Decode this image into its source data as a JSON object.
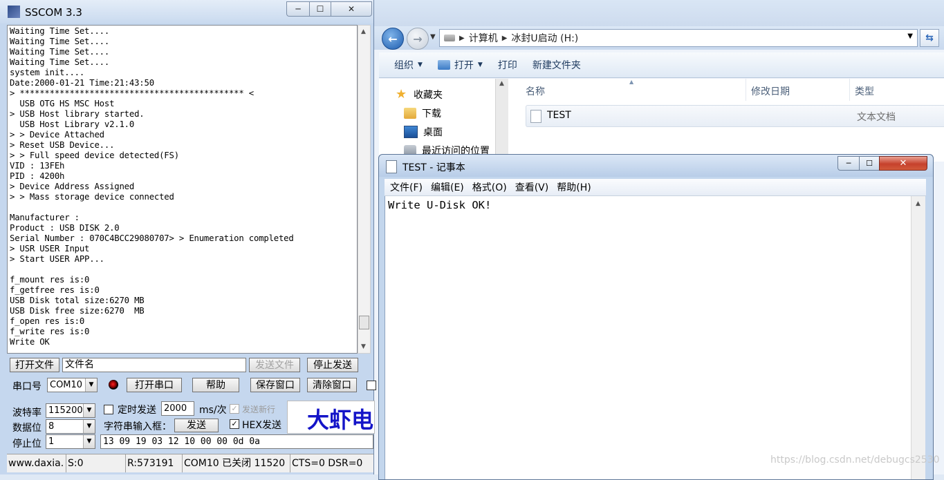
{
  "explorer": {
    "breadcrumb": [
      "计算机",
      "冰封U启动 (H:)"
    ],
    "toolbar": [
      "组织",
      "打开",
      "打印",
      "新建文件夹"
    ],
    "nav_items": [
      "收藏夹",
      "下载",
      "桌面",
      "最近访问的位置"
    ],
    "columns": [
      "名称",
      "修改日期",
      "类型"
    ],
    "file": {
      "name": "TEST",
      "type": "文本文档"
    }
  },
  "sscom": {
    "title": "SSCOM 3.3",
    "console": "Waiting Time Set....\nWaiting Time Set....\nWaiting Time Set....\nWaiting Time Set....\nsystem init....\nDate:2000-01-21 Time:21:43:50\n> ********************************************* <\n  USB OTG HS MSC Host\n> USB Host library started.\n  USB Host Library v2.1.0\n> > Device Attached\n> Reset USB Device...\n> > Full speed device detected(FS)\nVID : 13FEh\nPID : 4200h\n> Device Address Assigned\n> > Mass storage device connected\n\nManufacturer :\nProduct : USB DISK 2.0\nSerial Number : 070C4BCC29080707> > Enumeration completed\n> USR USER Input\n> Start USER APP...\n\nf_mount res is:0\nf_getfree res is:0\nUSB Disk total size:6270 MB\nUSB Disk free size:6270  MB\nf_open res is:0\nf_write res is:0\nWrite OK",
    "open_file_button": "打开文件",
    "file_name_input": "文件名",
    "send_file_button": "发送文件",
    "stop_send_button": "停止发送",
    "port_label": "串口号",
    "port_value": "COM10",
    "open_port_button": "打开串口",
    "help_button": "帮助",
    "save_window_button": "保存窗口",
    "clear_window_button": "清除窗口",
    "baud_label": "波特率",
    "baud_value": "115200",
    "data_bits_label": "数据位",
    "data_bits_value": "8",
    "stop_bits_label": "停止位",
    "stop_bits_value": "1",
    "timed_send_label": "定时发送",
    "interval_value": "2000",
    "interval_unit": "ms/次",
    "send_newline_label": "发送新行",
    "string_input_label": "字符串输入框：",
    "send_button": "发送",
    "hex_send_label": "HEX发送",
    "hex_send_checked": true,
    "send_input_value": "13 09 19 03 12 10 00 00 0d 0a",
    "banner": "大虾电",
    "status": {
      "website": "www.daxia.",
      "sent": "S:0",
      "received": "R:573191",
      "port_status": "COM10 已关闭  11520",
      "signals": "CTS=0 DSR=0"
    }
  },
  "notepad": {
    "title": "TEST - 记事本",
    "menus": [
      "文件(F)",
      "编辑(E)",
      "格式(O)",
      "查看(V)",
      "帮助(H)"
    ],
    "content": "Write U-Disk OK!"
  },
  "watermark": "https://blog.csdn.net/debugcs2530"
}
